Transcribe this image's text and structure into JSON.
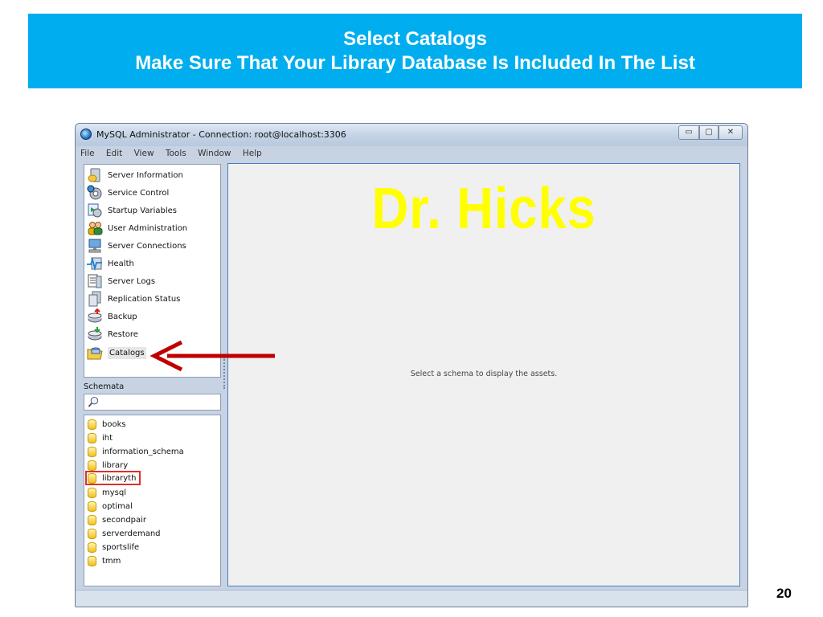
{
  "slide": {
    "title_line1": "Select Catalogs",
    "title_line2": "Make Sure That Your Library Database Is Included In The List",
    "page_number": "20",
    "watermark": "Dr. Hicks"
  },
  "window": {
    "title": "MySQL Administrator - Connection: root@localhost:3306",
    "controls": {
      "minimize": "▭",
      "maximize": "▢",
      "close": "✕"
    }
  },
  "menu": [
    "File",
    "Edit",
    "View",
    "Tools",
    "Window",
    "Help"
  ],
  "sidebar": {
    "items": [
      {
        "label": "Server Information",
        "icon": "server-info-icon"
      },
      {
        "label": "Service Control",
        "icon": "service-control-icon"
      },
      {
        "label": "Startup Variables",
        "icon": "startup-variables-icon"
      },
      {
        "label": "User Administration",
        "icon": "user-admin-icon"
      },
      {
        "label": "Server Connections",
        "icon": "server-connections-icon"
      },
      {
        "label": "Health",
        "icon": "health-icon"
      },
      {
        "label": "Server Logs",
        "icon": "server-logs-icon"
      },
      {
        "label": "Replication Status",
        "icon": "replication-icon"
      },
      {
        "label": "Backup",
        "icon": "backup-icon"
      },
      {
        "label": "Restore",
        "icon": "restore-icon"
      },
      {
        "label": "Catalogs",
        "icon": "catalogs-icon",
        "selected": true
      }
    ]
  },
  "schemata": {
    "label": "Schemata",
    "search_icon": "search-icon",
    "items": [
      "books",
      "iht",
      "information_schema",
      "library",
      "libraryth",
      "mysql",
      "optimal",
      "secondpair",
      "serverdemand",
      "sportslife",
      "tmm"
    ],
    "highlighted": "libraryth"
  },
  "main": {
    "empty_message": "Select a schema to display the assets."
  },
  "colors": {
    "banner": "#00aeef",
    "watermark": "#ffff00",
    "arrow": "#c00000",
    "highlight_box": "#e0302a"
  }
}
